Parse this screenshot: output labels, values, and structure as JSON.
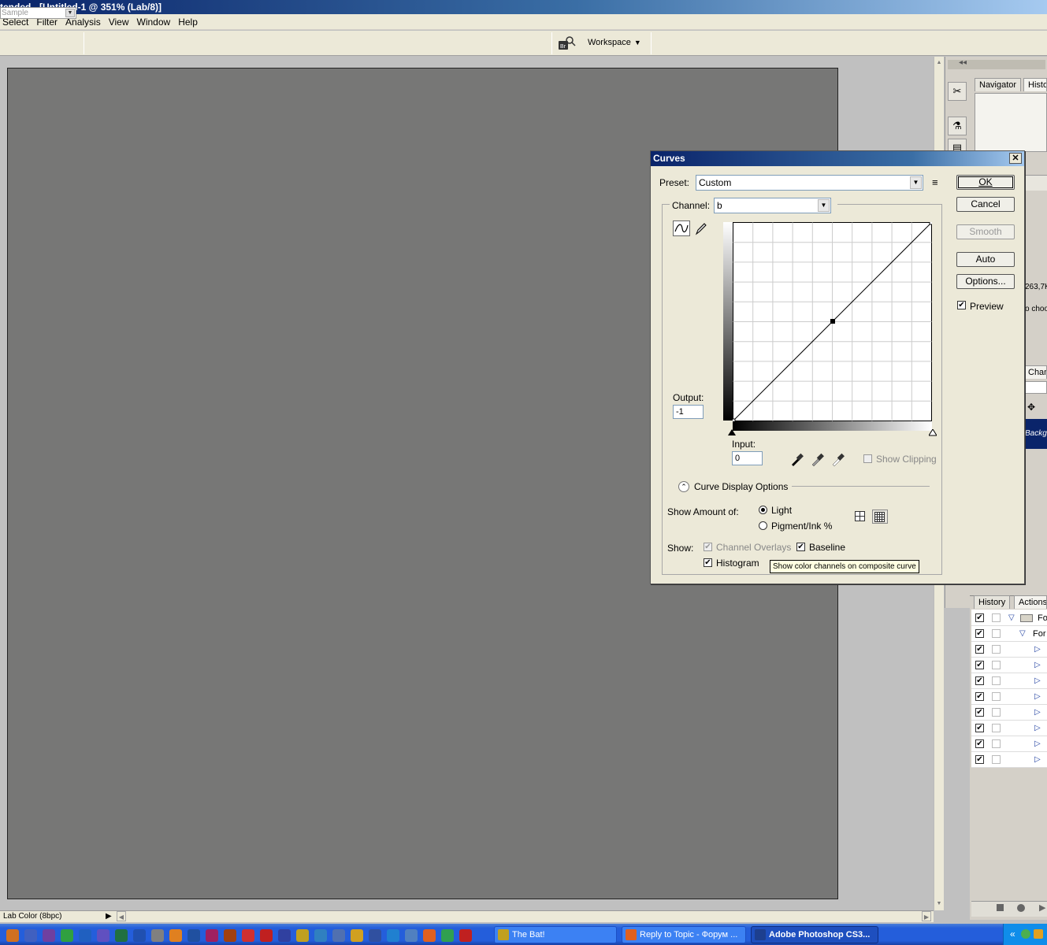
{
  "window": {
    "title": "tended - [Untitled-1 @ 351% (Lab/8)]"
  },
  "menu": [
    "Select",
    "Filter",
    "Analysis",
    "View",
    "Window",
    "Help"
  ],
  "options_bar": {
    "sample_value": "Sample",
    "workspace_label": "Workspace"
  },
  "dock": {
    "tabs_top": [
      "Navigator",
      "Histo"
    ],
    "info_fragments": [
      "263,7K",
      "o choo"
    ],
    "channels_tab": "Chann",
    "layer_label": "Backgr",
    "tabs_lower": [
      "History",
      "Actions"
    ],
    "action_rows": [
      {
        "checked": true,
        "text": "Fo",
        "kind": "folder"
      },
      {
        "checked": true,
        "text": "For",
        "kind": "set"
      },
      {
        "checked": true,
        "text": "",
        "kind": "item"
      },
      {
        "checked": true,
        "text": "",
        "kind": "item"
      },
      {
        "checked": true,
        "text": "",
        "kind": "item"
      },
      {
        "checked": true,
        "text": "",
        "kind": "item"
      },
      {
        "checked": true,
        "text": "",
        "kind": "item"
      },
      {
        "checked": true,
        "text": "",
        "kind": "item"
      },
      {
        "checked": true,
        "text": "",
        "kind": "item"
      },
      {
        "checked": true,
        "text": "",
        "kind": "item"
      }
    ]
  },
  "curves": {
    "title": "Curves",
    "close_glyph": "✕",
    "preset_label": "Preset:",
    "preset_value": "Custom",
    "channel_label": "Channel:",
    "channel_value": "b",
    "output_label": "Output:",
    "output_value": "-1",
    "input_label": "Input:",
    "input_value": "0",
    "show_clipping": "Show Clipping",
    "display_options": "Curve Display Options",
    "show_amount_label": "Show Amount of:",
    "light_label": "Light",
    "pigment_label": "Pigment/Ink %",
    "show_label": "Show:",
    "channel_overlays": "Channel Overlays",
    "baseline": "Baseline",
    "histogram": "Histogram",
    "buttons": {
      "ok": "OK",
      "cancel": "Cancel",
      "smooth": "Smooth",
      "auto": "Auto",
      "options": "Options..."
    },
    "preview_label": "Preview",
    "preview_checked": true,
    "curve_points": [
      [
        0,
        0
      ],
      [
        128,
        128
      ],
      [
        255,
        255
      ]
    ]
  },
  "tooltip": "Show color channels on composite curve",
  "status": {
    "doc_mode": "Lab Color (8bpc)"
  },
  "taskbar": {
    "buttons": [
      {
        "label": "The Bat!",
        "active": false
      },
      {
        "label": "Reply to Topic - Форум ...",
        "active": false
      },
      {
        "label": "Adobe Photoshop CS3...",
        "active": true
      }
    ],
    "quicklaunch": [
      "firefox-icon",
      "photoshop-elements-icon",
      "premiere-icon",
      "green-app-icon",
      "pagemaker-icon",
      "onenote-icon",
      "excel-icon",
      "word-icon",
      "calculator-icon",
      "illustrator-icon",
      "photoshop-icon",
      "indesign-icon",
      "bridge-icon",
      "acrobat-icon",
      "acrobat-reader-icon",
      "visio-icon",
      "the-bat-icon",
      "network-icon",
      "shield-icon",
      "pencil-icon",
      "save-icon",
      "ie-icon",
      "browser-icon",
      "firefox-icon",
      "chrome-icon",
      "opera-icon"
    ]
  },
  "colors": {
    "canvas": "#777776",
    "titlebar": "#0a246a",
    "workspace": "#c0c0c0"
  }
}
